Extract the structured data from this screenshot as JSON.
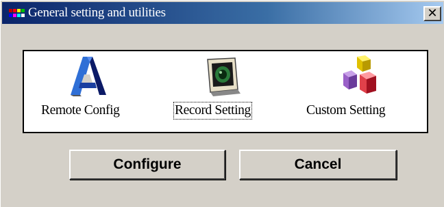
{
  "window": {
    "title": "General setting and utilities",
    "close_label": "✕"
  },
  "tools": [
    {
      "label": "Remote Config",
      "icon": "remote-config-icon"
    },
    {
      "label": "Record Setting",
      "icon": "record-setting-icon",
      "focused": true
    },
    {
      "label": "Custom Setting",
      "icon": "custom-setting-icon"
    }
  ],
  "buttons": {
    "configure": "Configure",
    "cancel": "Cancel"
  },
  "colors": {
    "title_start": "#0a246a",
    "title_end": "#a6caf0",
    "face": "#d4d0c8"
  }
}
